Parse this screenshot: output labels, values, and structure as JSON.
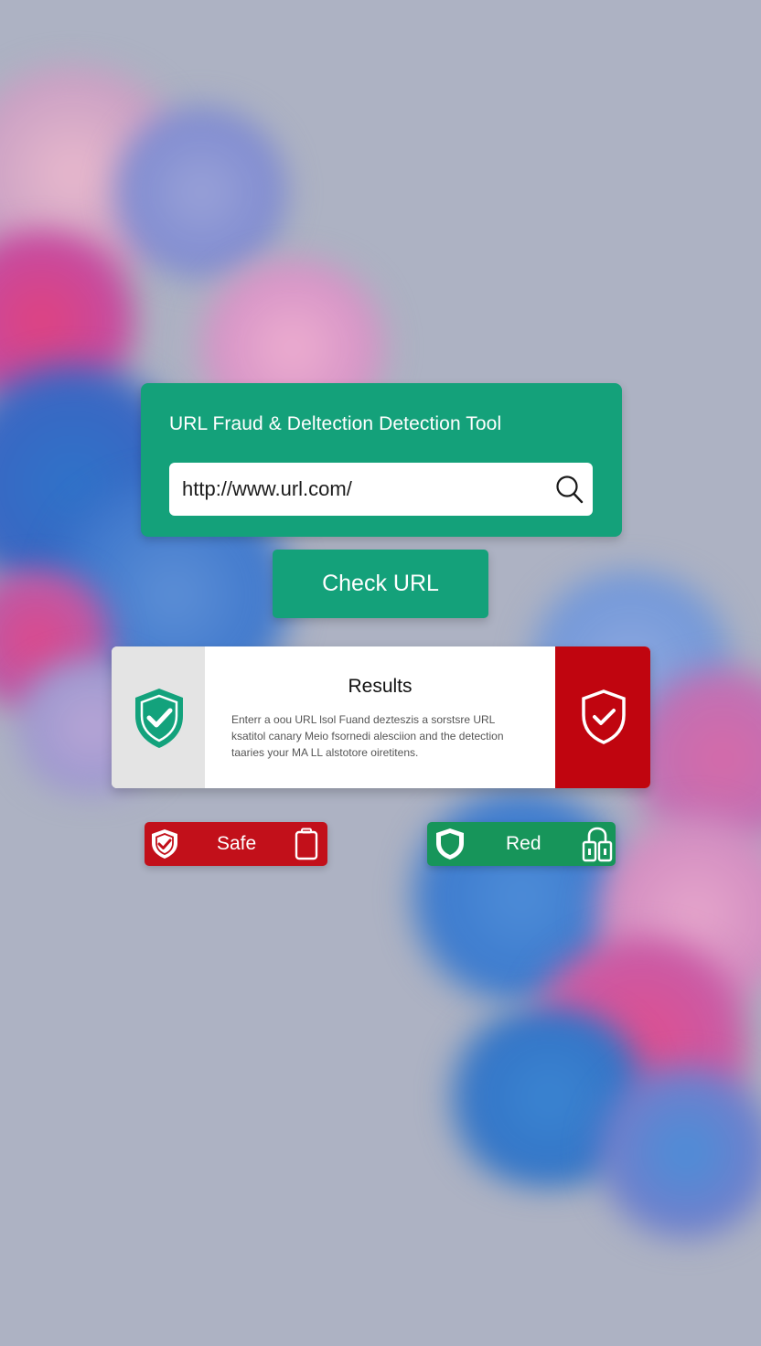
{
  "app": {
    "title": "URL Fraud & Deltection Detection Tool"
  },
  "url_input": {
    "value": "http://www.url.com/",
    "placeholder": "http://www.url.com/"
  },
  "check_button": {
    "label": "Check URL"
  },
  "results": {
    "title": "Results",
    "description_lines": [
      "Enterr a oou URL lsol Fuand dezteszis a sorstsre URL",
      "ksatitol canary Meio fsornedi alesciion and the detection",
      "taaries your MA LL alstotore oiretitens."
    ]
  },
  "badges": [
    {
      "label": "Safe",
      "color": "#c2101a",
      "icons": [
        "shield-check-icon",
        "phone-icon"
      ]
    },
    {
      "label": "Red",
      "color": "#17955a",
      "icons": [
        "shield-icon",
        "padlock-icon"
      ]
    }
  ],
  "colors": {
    "accent": "#14a17a",
    "danger": "#c0050f",
    "background": "#adb2c3"
  }
}
